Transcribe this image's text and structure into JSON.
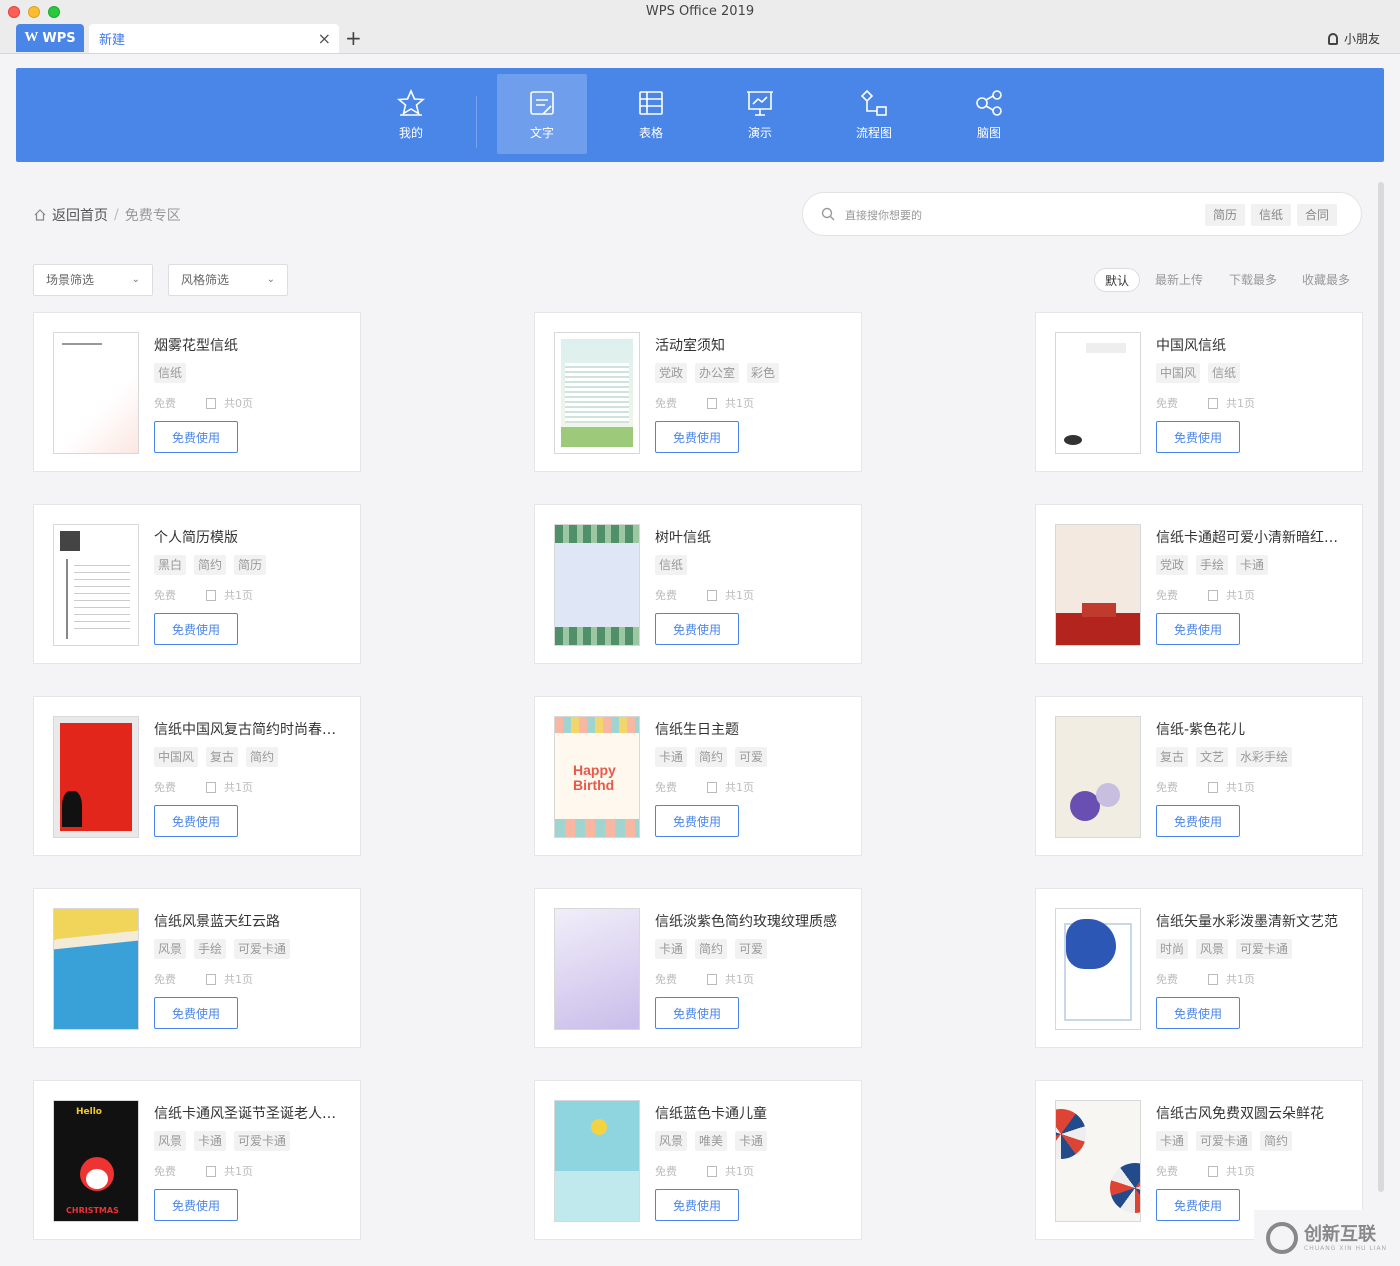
{
  "window": {
    "title": "WPS Office 2019"
  },
  "tabs": {
    "wps_label": "WPS",
    "doc_label": "新建",
    "close": "×",
    "add": "+"
  },
  "user": {
    "name": "小朋友"
  },
  "nav": [
    {
      "label": "我的",
      "icon": "star-icon"
    },
    {
      "label": "文字",
      "icon": "document-icon",
      "active": true
    },
    {
      "label": "表格",
      "icon": "table-icon"
    },
    {
      "label": "演示",
      "icon": "presentation-icon"
    },
    {
      "label": "流程图",
      "icon": "flowchart-icon"
    },
    {
      "label": "脑图",
      "icon": "mindmap-icon"
    }
  ],
  "breadcrumb": {
    "home": "返回首页",
    "sep": "/",
    "current": "免费专区"
  },
  "search": {
    "placeholder": "直接搜你想要的",
    "tags": [
      "简历",
      "信纸",
      "合同"
    ]
  },
  "filters": {
    "scene": "场景筛选",
    "style": "风格筛选"
  },
  "sort": [
    "默认",
    "最新上传",
    "下载最多",
    "收藏最多"
  ],
  "card_common": {
    "price": "免费",
    "button": "免费使用"
  },
  "cards": [
    {
      "title": "烟雾花型信纸",
      "tags": [
        "信纸"
      ],
      "pages": "共0页"
    },
    {
      "title": "活动室须知",
      "tags": [
        "党政",
        "办公室",
        "彩色"
      ],
      "pages": "共1页"
    },
    {
      "title": "中国风信纸",
      "tags": [
        "中国风",
        "信纸"
      ],
      "pages": "共1页"
    },
    {
      "title": "个人简历模版",
      "tags": [
        "黑白",
        "简约",
        "简历"
      ],
      "pages": "共1页"
    },
    {
      "title": "树叶信纸",
      "tags": [
        "信纸"
      ],
      "pages": "共1页"
    },
    {
      "title": "信纸卡通超可爱小清新暗红…",
      "tags": [
        "党政",
        "手绘",
        "卡通"
      ],
      "pages": "共1页"
    },
    {
      "title": "信纸中国风复古简约时尚春…",
      "tags": [
        "中国风",
        "复古",
        "简约"
      ],
      "pages": "共1页"
    },
    {
      "title": "信纸生日主题",
      "tags": [
        "卡通",
        "简约",
        "可爱"
      ],
      "pages": "共1页"
    },
    {
      "title": "信纸-紫色花儿",
      "tags": [
        "复古",
        "文艺",
        "水彩手绘"
      ],
      "pages": "共1页"
    },
    {
      "title": "信纸风景蓝天红云路",
      "tags": [
        "风景",
        "手绘",
        "可爱卡通"
      ],
      "pages": "共1页"
    },
    {
      "title": "信纸淡紫色简约玫瑰纹理质感",
      "tags": [
        "卡通",
        "简约",
        "可爱"
      ],
      "pages": "共1页"
    },
    {
      "title": "信纸矢量水彩泼墨清新文艺范",
      "tags": [
        "时尚",
        "风景",
        "可爱卡通"
      ],
      "pages": "共1页"
    },
    {
      "title": "信纸卡通风圣诞节圣诞老人…",
      "tags": [
        "风景",
        "卡通",
        "可爱卡通"
      ],
      "pages": "共1页"
    },
    {
      "title": "信纸蓝色卡通儿童",
      "tags": [
        "风景",
        "唯美",
        "卡通"
      ],
      "pages": "共1页"
    },
    {
      "title": "信纸古风免费双圆云朵鲜花",
      "tags": [
        "卡通",
        "可爱卡通",
        "简约"
      ],
      "pages": "共1页"
    }
  ],
  "thumb_text": {
    "birthday": "Happy Birthd",
    "hello": "Hello",
    "christmas": "CHRISTMAS"
  },
  "corner_logo": {
    "cn": "创新互联",
    "en": "CHUANG XIN HU LIAN"
  },
  "colors": {
    "accent": "#4a86e8"
  }
}
